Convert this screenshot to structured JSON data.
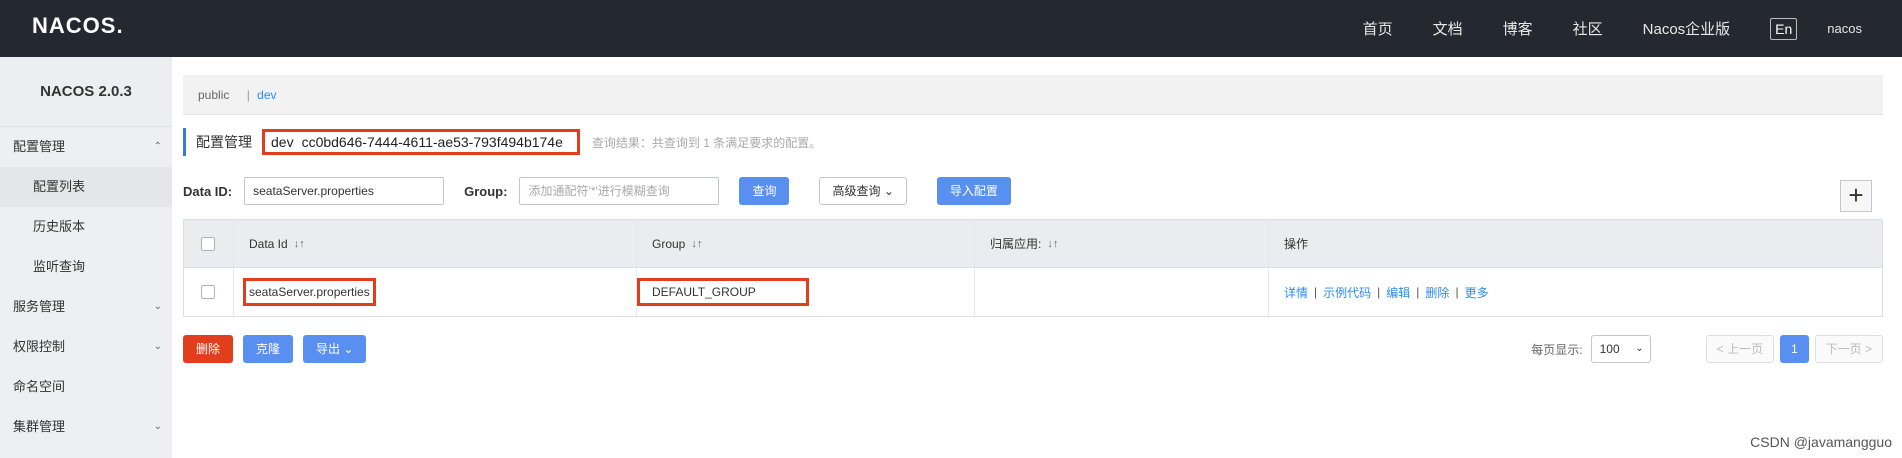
{
  "topbar": {
    "logo": "NACOS.",
    "nav": [
      "首页",
      "文档",
      "博客",
      "社区",
      "Nacos企业版"
    ],
    "lang": "En",
    "user": "nacos"
  },
  "sidebar": {
    "version": "NACOS 2.0.3",
    "items": [
      {
        "label": "配置管理",
        "chevron": "up"
      },
      {
        "label": "配置列表"
      },
      {
        "label": "历史版本"
      },
      {
        "label": "监听查询"
      },
      {
        "label": "服务管理",
        "chevron": "down"
      },
      {
        "label": "权限控制",
        "chevron": "down"
      },
      {
        "label": "命名空间"
      },
      {
        "label": "集群管理",
        "chevron": "down"
      }
    ]
  },
  "namespaces": {
    "first": "public",
    "second": "dev"
  },
  "header": {
    "title": "配置管理",
    "ns_name": "dev",
    "ns_id": "cc0bd646-7444-4611-ae53-793f494b174e",
    "result": "查询结果：共查询到 1 条满足要求的配置。"
  },
  "search": {
    "dataid_label": "Data ID:",
    "dataid_value": "seataServer.properties",
    "group_label": "Group:",
    "group_placeholder": "添加通配符'*'进行模糊查询",
    "query_btn": "查询",
    "advanced_btn": "高级查询",
    "import_btn": "导入配置",
    "add_btn": "+"
  },
  "table": {
    "headers": {
      "dataid": "Data Id",
      "group": "Group",
      "app": "归属应用:",
      "op": "操作"
    },
    "rows": [
      {
        "dataid": "seataServer.properties",
        "group": "DEFAULT_GROUP",
        "app": "",
        "ops": [
          "详情",
          "示例代码",
          "编辑",
          "删除",
          "更多"
        ]
      }
    ]
  },
  "actions": {
    "delete": "删除",
    "clone": "克隆",
    "export": "导出"
  },
  "pager": {
    "label": "每页显示:",
    "size": "100",
    "prev": "上一页",
    "page": "1",
    "next": "下一页"
  },
  "watermark": "CSDN @javamangguo",
  "colors": {
    "topbar": "#242830",
    "accent": "#5a8ff2",
    "danger": "#e23d1c",
    "link": "#2d8cf0"
  }
}
